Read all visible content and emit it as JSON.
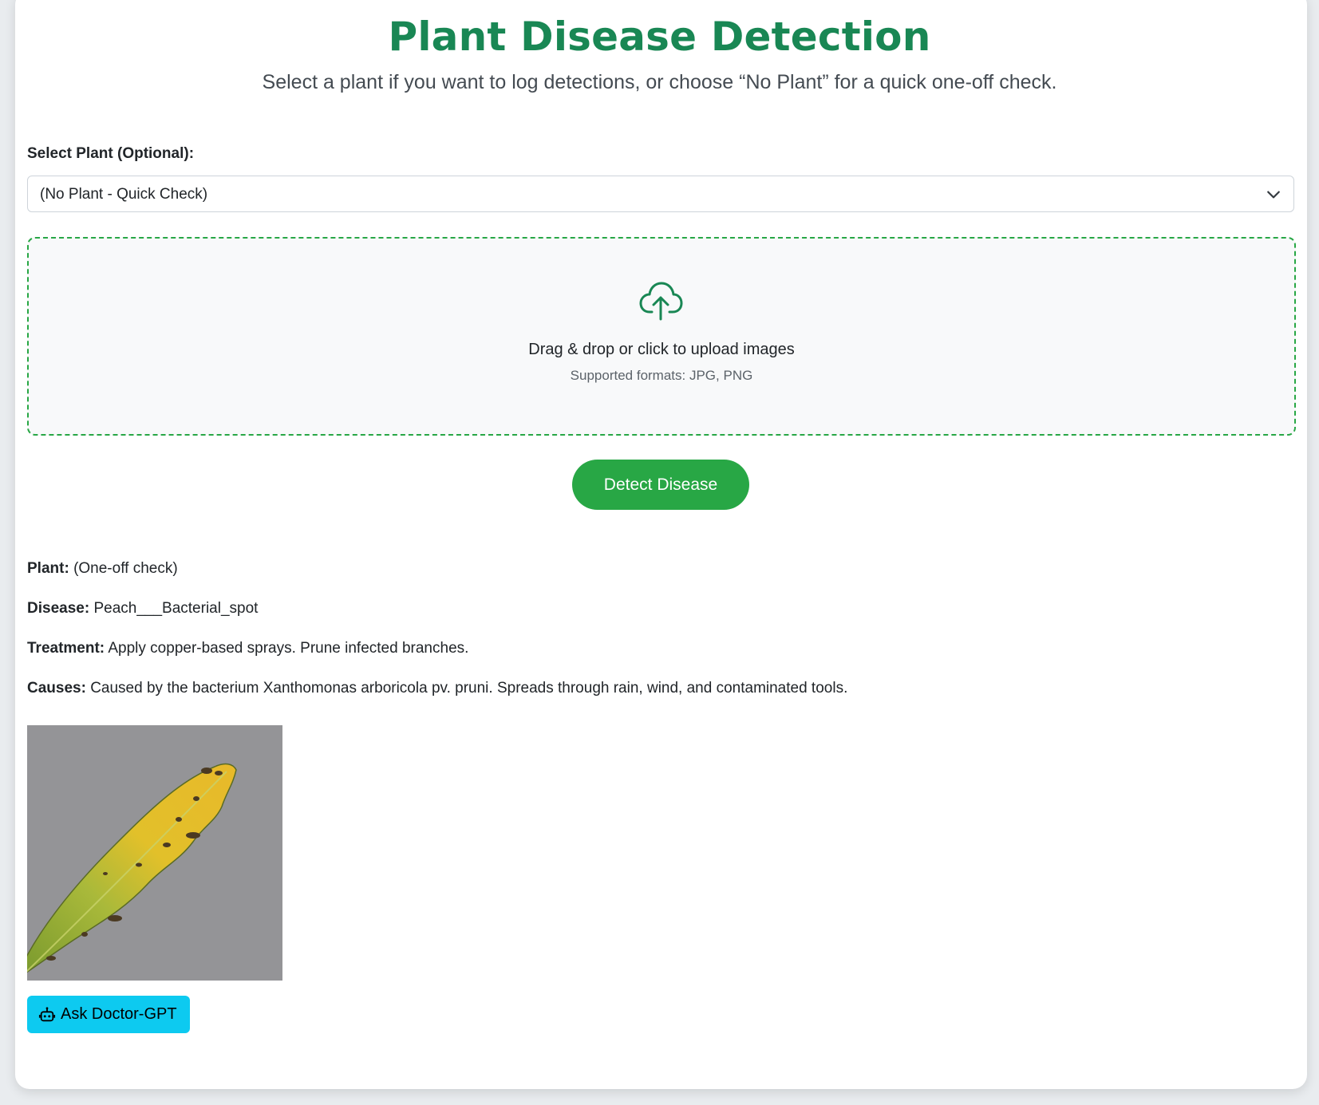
{
  "header": {
    "title": "Plant Disease Detection",
    "subtitle": "Select a plant if you want to log detections, or choose “No Plant” for a quick one-off check."
  },
  "plant_select": {
    "label": "Select Plant (Optional):",
    "selected": "(No Plant - Quick Check)",
    "icon": "chevron-down-icon"
  },
  "upload": {
    "icon": "cloud-upload-icon",
    "prompt": "Drag & drop or click to upload images",
    "formats": "Supported formats: JPG, PNG"
  },
  "detect_button": {
    "label": "Detect Disease"
  },
  "result": {
    "plant_label": "Plant:",
    "plant_value": "(One-off check)",
    "disease_label": "Disease:",
    "disease_value": "Peach___Bacterial_spot",
    "treatment_label": "Treatment:",
    "treatment_value": "Apply copper-based sprays. Prune infected branches.",
    "causes_label": "Causes:",
    "causes_value": "Caused by the bacterium Xanthomonas arboricola pv. pruni. Spreads through rain, wind, and contaminated tools."
  },
  "ask_button": {
    "label": "Ask Doctor-GPT",
    "icon": "robot-icon"
  },
  "colors": {
    "title": "#198754",
    "primary_button": "#28a745",
    "dropzone_border": "#28a745",
    "ask_button": "#0dcaf0"
  }
}
